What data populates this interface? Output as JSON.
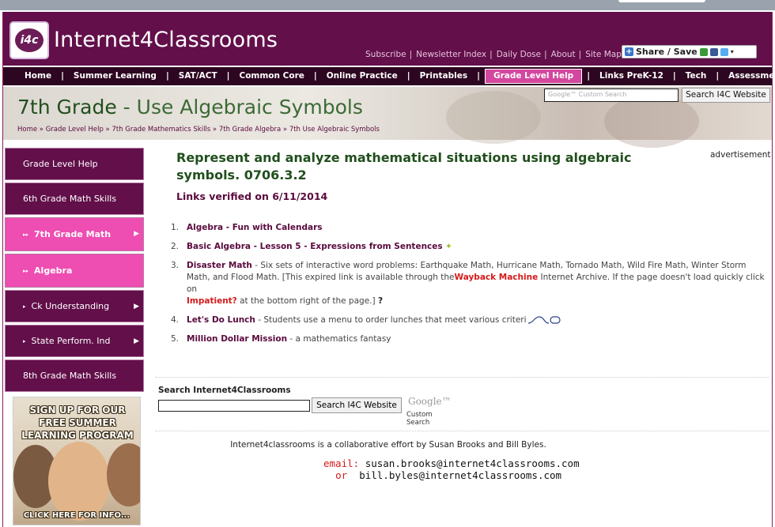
{
  "header": {
    "logo_text": "i4c",
    "site_title": "Internet4Classrooms",
    "top_links": [
      "Subscribe",
      "Newsletter Index",
      "Daily Dose",
      "About",
      "Site Map"
    ],
    "share_label": "Share / Save"
  },
  "nav": {
    "items": [
      "Home",
      "Summer Learning",
      "SAT/ACT",
      "Common Core",
      "Online Practice",
      "Printables",
      "Grade Level Help",
      "Links PreK-12",
      "Tech",
      "Assessment"
    ],
    "active": "Grade Level Help"
  },
  "banner": {
    "title_a": "7th Grade",
    "title_b": " - Use Algebraic Symbols",
    "breadcrumb": [
      "Home",
      "Grade Level Help",
      "7th Grade Mathematics Skills",
      "7th Grade Algebra",
      "7th Use Algebraic Symbols"
    ],
    "search_placeholder": "Google™ Custom Search",
    "search_button": "Search I4C Website"
  },
  "sidebar": {
    "items": [
      {
        "label": "Grade Level Help",
        "style": "dark",
        "indent": "none"
      },
      {
        "label": "6th Grade Math Skills",
        "style": "dark",
        "indent": "none"
      },
      {
        "label": "7th Grade Math",
        "style": "pink",
        "indent": "double"
      },
      {
        "label": "Algebra",
        "style": "pink",
        "indent": "double"
      },
      {
        "label": "Ck Understanding",
        "style": "dark",
        "indent": "single"
      },
      {
        "label": "State Perform. Ind",
        "style": "dark",
        "indent": "single"
      },
      {
        "label": "8th Grade Math Skills",
        "style": "dark",
        "indent": "none"
      }
    ],
    "ad": {
      "headline": "SIGN UP FOR OUR FREE SUMMER LEARNING PROGRAM",
      "cta": "CLICK HERE FOR INFO..."
    }
  },
  "main": {
    "advert_label": "advertisement",
    "heading": "Represent and analyze mathematical situations using algebraic symbols. 0706.3.2",
    "verified": "Links verified on 6/11/2014",
    "links": [
      {
        "n": "1.",
        "title": "Algebra - Fun with Calendars",
        "desc": ""
      },
      {
        "n": "2.",
        "title": "Basic Algebra - Lesson 5 - Expressions from Sentences",
        "desc": ""
      },
      {
        "n": "3.",
        "title": "Disaster Math",
        "desc": " - Six sets of interactive word problems: Earthquake Math, Hurricane Math, Tornado Math, Wild Fire Math, Winter Storm Math, and Flood Math. [This expired link is available through the",
        "red1": "Wayback Machine",
        "desc2": " Internet Archive. If the page doesn't load quickly click on",
        "red2": "Impatient?",
        "desc3": " at the bottom right of the page.]"
      },
      {
        "n": "4.",
        "title": "Let's Do Lunch",
        "desc": " - Students use a menu to order lunches that meet various criteri"
      },
      {
        "n": "5.",
        "title": "Million Dollar Mission",
        "desc": " - a mathematics fantasy"
      }
    ],
    "search": {
      "label": "Search Internet4Classrooms",
      "button": "Search I4C Website",
      "google": "Google™",
      "custom": "Custom Search"
    },
    "footer": {
      "collab": "Internet4classrooms is a collaborative effort by Susan Brooks and Bill Byles.",
      "email_label": "email:",
      "email1": "susan.brooks@internet4classrooms.com",
      "or_label": "or",
      "email2": "bill.byles@internet4classrooms.com"
    }
  },
  "colors": {
    "brand": "#620f4a",
    "nav_dark": "#2d0621",
    "active_pink": "#ee4db2",
    "title_green": "#214f1d"
  }
}
